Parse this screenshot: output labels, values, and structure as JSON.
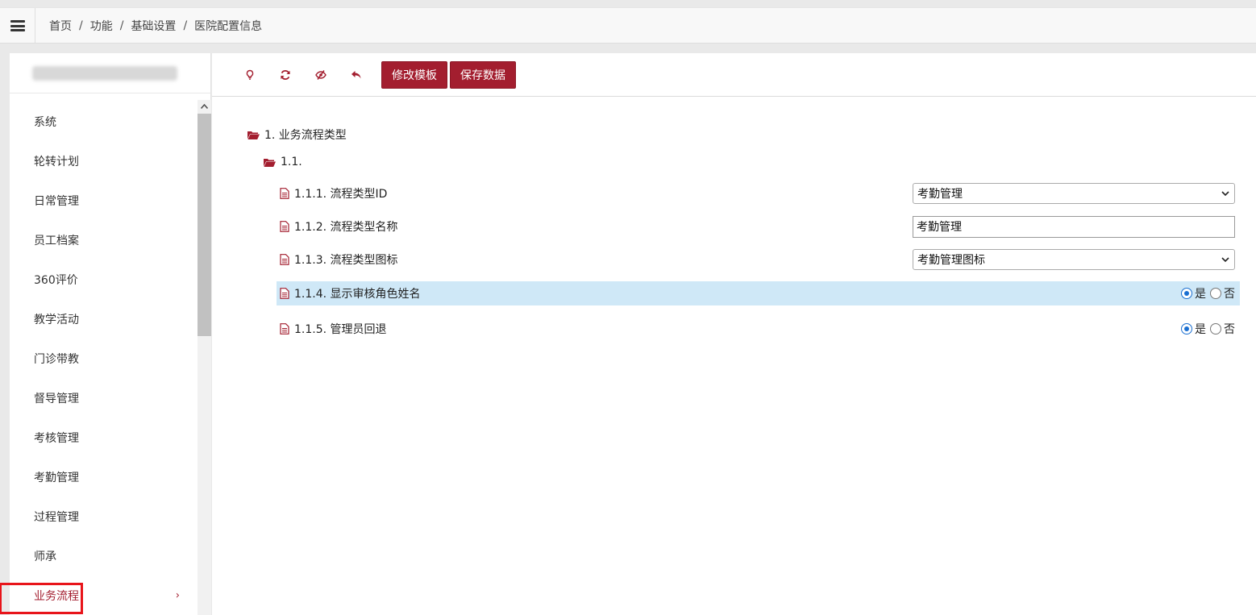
{
  "breadcrumb": [
    "首页",
    "功能",
    "基础设置",
    "医院配置信息"
  ],
  "breadcrumb_sep": "/",
  "sidebar": {
    "items": [
      {
        "label": "系统"
      },
      {
        "label": "轮转计划"
      },
      {
        "label": "日常管理"
      },
      {
        "label": "员工档案"
      },
      {
        "label": "360评价"
      },
      {
        "label": "教学活动"
      },
      {
        "label": "门诊带教"
      },
      {
        "label": "督导管理"
      },
      {
        "label": "考核管理"
      },
      {
        "label": "考勤管理"
      },
      {
        "label": "过程管理"
      },
      {
        "label": "师承"
      },
      {
        "label": "业务流程",
        "active": true
      }
    ],
    "chevron": "›"
  },
  "toolbar": {
    "icons": [
      "lightbulb-icon",
      "refresh-icon",
      "eye-slash-icon",
      "undo-icon"
    ],
    "edit_template_label": "修改模板",
    "save_data_label": "保存数据"
  },
  "tree": {
    "root_label": "1. 业务流程类型",
    "group_label": "1.1.",
    "rows": [
      {
        "label": "1.1.1. 流程类型ID",
        "control": "select",
        "value": "考勤管理"
      },
      {
        "label": "1.1.2. 流程类型名称",
        "control": "text",
        "value": "考勤管理"
      },
      {
        "label": "1.1.3. 流程类型图标",
        "control": "select",
        "value": "考勤管理图标"
      },
      {
        "label": "1.1.4. 显示审核角色姓名",
        "control": "radio",
        "yes": "是",
        "no": "否",
        "selected": "是",
        "highlighted": true
      },
      {
        "label": "1.1.5. 管理员回退",
        "control": "radio",
        "yes": "是",
        "no": "否",
        "selected": "是"
      }
    ]
  },
  "colors": {
    "accent": "#a31e2f",
    "highlight_row": "#cfe8f7",
    "active_outline": "#e8141a",
    "radio_on": "#1a6fd1"
  }
}
